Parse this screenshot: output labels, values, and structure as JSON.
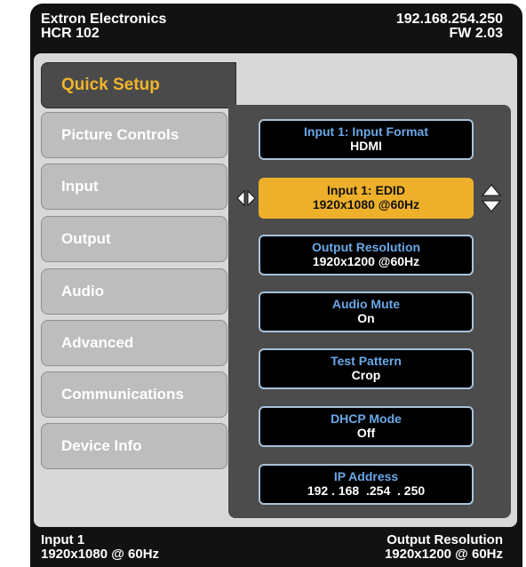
{
  "header": {
    "brand": "Extron Electronics",
    "model": "HCR 102",
    "ip": "192.168.254.250",
    "firmware": "FW 2.03"
  },
  "tabs": [
    {
      "label": "Quick Setup",
      "active": true
    },
    {
      "label": "Picture Controls",
      "active": false
    },
    {
      "label": "Input",
      "active": false
    },
    {
      "label": "Output",
      "active": false
    },
    {
      "label": "Audio",
      "active": false
    },
    {
      "label": "Advanced",
      "active": false
    },
    {
      "label": "Communications",
      "active": false
    },
    {
      "label": "Device Info",
      "active": false
    }
  ],
  "items": [
    {
      "label": "Input 1: Input Format",
      "value": "HDMI",
      "selected": false
    },
    {
      "label": "Input 1: EDID",
      "value": "1920x1080 @60Hz",
      "selected": true
    },
    {
      "label": "Output Resolution",
      "value": "1920x1200 @60Hz",
      "selected": false
    },
    {
      "label": "Audio Mute",
      "value": "On",
      "selected": false
    },
    {
      "label": "Test Pattern",
      "value": "Crop",
      "selected": false
    },
    {
      "label": "DHCP Mode",
      "value": "Off",
      "selected": false
    },
    {
      "label": "IP Address",
      "value": "192 . 168  .254  . 250",
      "selected": false
    }
  ],
  "footer": {
    "input_label": "Input 1",
    "input_value": "1920x1080 @ 60Hz",
    "output_label": "Output Resolution",
    "output_value": "1920x1200 @ 60Hz"
  },
  "colors": {
    "accent": "#eeb02b",
    "item_label": "#6aa8e8",
    "frame": "#121212"
  }
}
